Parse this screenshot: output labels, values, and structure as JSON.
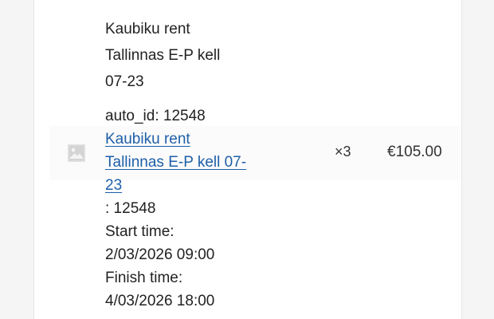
{
  "item": {
    "title": "Kaubiku rent Tallinnas E-P kell 07-23",
    "auto_id_line": "auto_id: 12548",
    "link_text": "Kaubiku rent Tallinnas E-P kell 07-23",
    "id_suffix": ": 12548",
    "start_label": "Start time:",
    "start_value": "2/03/2026 09:00",
    "finish_label": "Finish time:",
    "finish_value": "4/03/2026 18:00",
    "quantity": "×3",
    "price": "€105.00",
    "thumbnail_icon": "image-placeholder-icon"
  }
}
